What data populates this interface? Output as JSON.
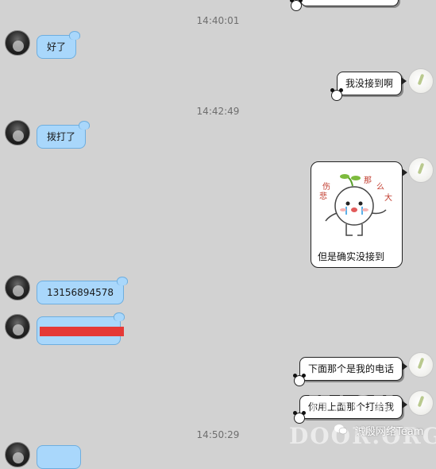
{
  "timestamps": [
    "14:40:01",
    "14:42:49",
    "14:50:29"
  ],
  "messages": {
    "m1": "好了",
    "m2": "我没接到啊",
    "m3": "拨打了",
    "m4": "但是确实没接到",
    "m5": "13156894578",
    "m7": "下面那个是我的电话",
    "m8": "你用上面那个打给我"
  },
  "sticker": {
    "chars": [
      "悲",
      "伤",
      "那",
      "么",
      "大"
    ]
  },
  "watermark": {
    "line1": "HACK",
    "line2": "DOOR.ORG",
    "team": "诚殷网络Team"
  },
  "colors": {
    "background": "#d2d2d2",
    "left_bubble": "#a9d7fb",
    "right_bubble": "#ffffff",
    "redaction": "#e53936"
  },
  "icons": [
    "avatar",
    "panda-icon",
    "wechat-icon",
    "sprout-sticker"
  ]
}
